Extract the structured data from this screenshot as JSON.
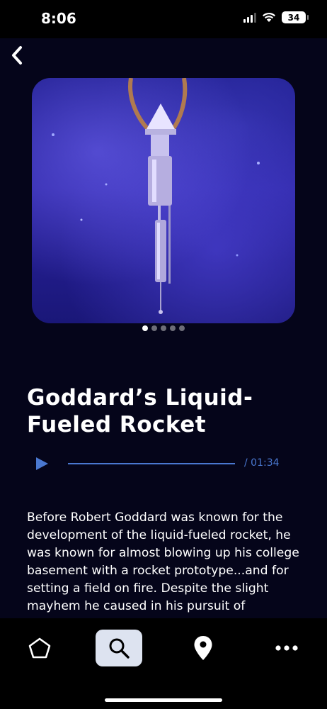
{
  "status_bar": {
    "time": "8:06",
    "battery": "34",
    "signal_icon": "cellular-signal-icon",
    "wifi_icon": "wifi-icon"
  },
  "nav": {
    "back_icon": "chevron-left-icon"
  },
  "carousel": {
    "image_subject": "liquid-fueled rocket model hanging against blue background",
    "total_slides": 5,
    "active_slide": 1
  },
  "article": {
    "title": "Goddard’s Liquid-Fueled Rocket",
    "description": "Before Robert Goddard was known for the development of the liquid-fueled rocket, he was known for almost blowing up his college basement with a rocket prototype...and for setting a field on fire. Despite the slight mayhem he caused in his pursuit of knowledge, Robert Goddard"
  },
  "audio": {
    "play_icon": "play-icon",
    "duration": "/ 01:34",
    "progress": 0,
    "accent_color": "#4a78d0"
  },
  "tab_bar": {
    "items": [
      {
        "icon": "home-icon",
        "active": false
      },
      {
        "icon": "search-icon",
        "active": true
      },
      {
        "icon": "location-pin-icon",
        "active": false
      },
      {
        "icon": "more-icon",
        "active": false
      }
    ]
  },
  "colors": {
    "background": "#05051a",
    "tab_active": "#dde3f0"
  }
}
